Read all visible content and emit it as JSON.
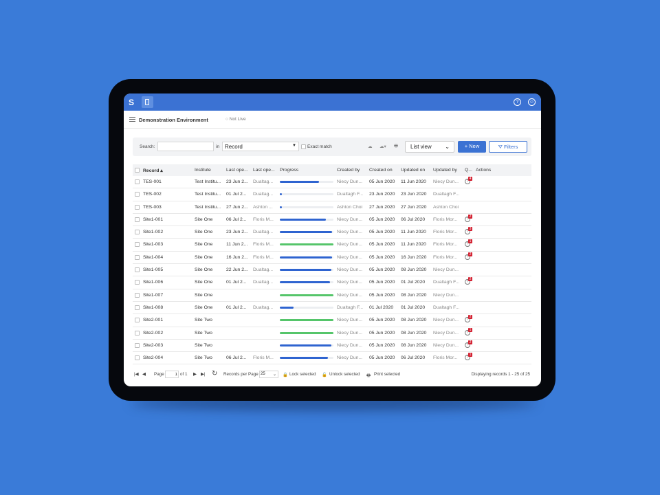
{
  "colors": {
    "background": "#3a7bd8",
    "header": "#3b72d3",
    "progress_blue": "#2f64d0",
    "progress_green": "#55c56a",
    "badge": "#d32030"
  },
  "topbar": {
    "logo": "S",
    "help_icon": "?",
    "user_icon": "user"
  },
  "subheader": {
    "title": "Demonstration Environment",
    "status": "○ Not Live"
  },
  "toolbar": {
    "search_label": "Search:",
    "search_value": "",
    "in_label": "in",
    "field_value": "Record",
    "exact_match": "Exact match",
    "view_value": "List view",
    "new_label": "+ New",
    "filters_label": "Filters"
  },
  "table": {
    "headers": [
      "Record ▴",
      "Institute",
      "Last ope...",
      "Last ope...",
      "Progress",
      "Created by",
      "Created on",
      "Updated on",
      "Updated by",
      "Q...",
      "Actions"
    ],
    "rows": [
      {
        "record": "TES-001",
        "institute": "Test Institu...",
        "last_date": "23 Jun 2...",
        "last_user": "Dualtag...",
        "progress": 73,
        "complete": false,
        "created_by": "Niecy Dun...",
        "created_on": "05 Jun 2020",
        "updated_on": "11 Jun 2020",
        "updated_by": "Niecy Dun...",
        "queries": "4"
      },
      {
        "record": "TES-002",
        "institute": "Test Institu...",
        "last_date": "01 Jul 2...",
        "last_user": "Dualtag...",
        "progress": 2,
        "complete": false,
        "created_by": "Dualtagh F...",
        "created_on": "23 Jun 2020",
        "updated_on": "23 Jun 2020",
        "updated_by": "Dualtagh F...",
        "queries": ""
      },
      {
        "record": "TES-003",
        "institute": "Test Institu...",
        "last_date": "27 Jun 2...",
        "last_user": "Ashton ...",
        "progress": 2,
        "complete": false,
        "created_by": "Ashton Choi",
        "created_on": "27 Jun 2020",
        "updated_on": "27 Jun 2020",
        "updated_by": "Ashton Choi",
        "queries": ""
      },
      {
        "record": "Site1-001",
        "institute": "Site One",
        "last_date": "06 Jul 2...",
        "last_user": "Floris M...",
        "progress": 86,
        "complete": false,
        "created_by": "Niecy Dun...",
        "created_on": "05 Jun 2020",
        "updated_on": "06 Jul 2020",
        "updated_by": "Floris Mor...",
        "queries": "2"
      },
      {
        "record": "Site1-002",
        "institute": "Site One",
        "last_date": "23 Jun 2...",
        "last_user": "Dualtag...",
        "progress": 97,
        "complete": false,
        "created_by": "Niecy Dun...",
        "created_on": "05 Jun 2020",
        "updated_on": "11 Jun 2020",
        "updated_by": "Floris Mor...",
        "queries": "3"
      },
      {
        "record": "Site1-003",
        "institute": "Site One",
        "last_date": "11 Jun 2...",
        "last_user": "Floris M...",
        "progress": 100,
        "complete": true,
        "created_by": "Niecy Dun...",
        "created_on": "05 Jun 2020",
        "updated_on": "11 Jun 2020",
        "updated_by": "Floris Mor...",
        "queries": "1"
      },
      {
        "record": "Site1-004",
        "institute": "Site One",
        "last_date": "16 Jun 2...",
        "last_user": "Floris M...",
        "progress": 97,
        "complete": false,
        "created_by": "Niecy Dun...",
        "created_on": "05 Jun 2020",
        "updated_on": "16 Jun 2020",
        "updated_by": "Floris Mor...",
        "queries": "2"
      },
      {
        "record": "Site1-005",
        "institute": "Site One",
        "last_date": "22 Jun 2...",
        "last_user": "Dualtag...",
        "progress": 96,
        "complete": false,
        "created_by": "Niecy Dun...",
        "created_on": "05 Jun 2020",
        "updated_on": "08 Jun 2020",
        "updated_by": "Niecy Dun...",
        "queries": ""
      },
      {
        "record": "Site1-006",
        "institute": "Site One",
        "last_date": "01 Jul 2...",
        "last_user": "Dualtag...",
        "progress": 93,
        "complete": false,
        "created_by": "Niecy Dun...",
        "created_on": "05 Jun 2020",
        "updated_on": "01 Jul 2020",
        "updated_by": "Dualtagh F...",
        "queries": "2"
      },
      {
        "record": "Site1-007",
        "institute": "Site One",
        "last_date": "",
        "last_user": "",
        "progress": 100,
        "complete": true,
        "created_by": "Niecy Dun...",
        "created_on": "05 Jun 2020",
        "updated_on": "08 Jun 2020",
        "updated_by": "Niecy Dun...",
        "queries": ""
      },
      {
        "record": "Site1-008",
        "institute": "Site One",
        "last_date": "01 Jul 2...",
        "last_user": "Dualtag...",
        "progress": 25,
        "complete": false,
        "created_by": "Dualtagh F...",
        "created_on": "01 Jul 2020",
        "updated_on": "01 Jul 2020",
        "updated_by": "Dualtagh F...",
        "queries": ""
      },
      {
        "record": "Site2-001",
        "institute": "Site Two",
        "last_date": "",
        "last_user": "",
        "progress": 100,
        "complete": true,
        "created_by": "Niecy Dun...",
        "created_on": "05 Jun 2020",
        "updated_on": "08 Jun 2020",
        "updated_by": "Niecy Dun...",
        "queries": "2"
      },
      {
        "record": "Site2-002",
        "institute": "Site Two",
        "last_date": "",
        "last_user": "",
        "progress": 100,
        "complete": true,
        "created_by": "Niecy Dun...",
        "created_on": "05 Jun 2020",
        "updated_on": "08 Jun 2020",
        "updated_by": "Niecy Dun...",
        "queries": "1"
      },
      {
        "record": "Site2-003",
        "institute": "Site Two",
        "last_date": "",
        "last_user": "",
        "progress": 96,
        "complete": false,
        "created_by": "Niecy Dun...",
        "created_on": "05 Jun 2020",
        "updated_on": "08 Jun 2020",
        "updated_by": "Niecy Dun...",
        "queries": "2"
      },
      {
        "record": "Site2-004",
        "institute": "Site Two",
        "last_date": "06 Jul 2...",
        "last_user": "Floris M...",
        "progress": 90,
        "complete": false,
        "created_by": "Niecy Dun...",
        "created_on": "05 Jun 2020",
        "updated_on": "06 Jul 2020",
        "updated_by": "Floris Mor...",
        "queries": "1"
      }
    ]
  },
  "footer": {
    "page_label": "Page",
    "page_value": "1",
    "of_label": "of 1",
    "records_per_page_label": "Records per Page",
    "records_per_page": "25",
    "lock": "Lock selected",
    "unlock": "Unlock selected",
    "print": "Print selected",
    "display": "Displaying records 1 - 25 of 25"
  }
}
